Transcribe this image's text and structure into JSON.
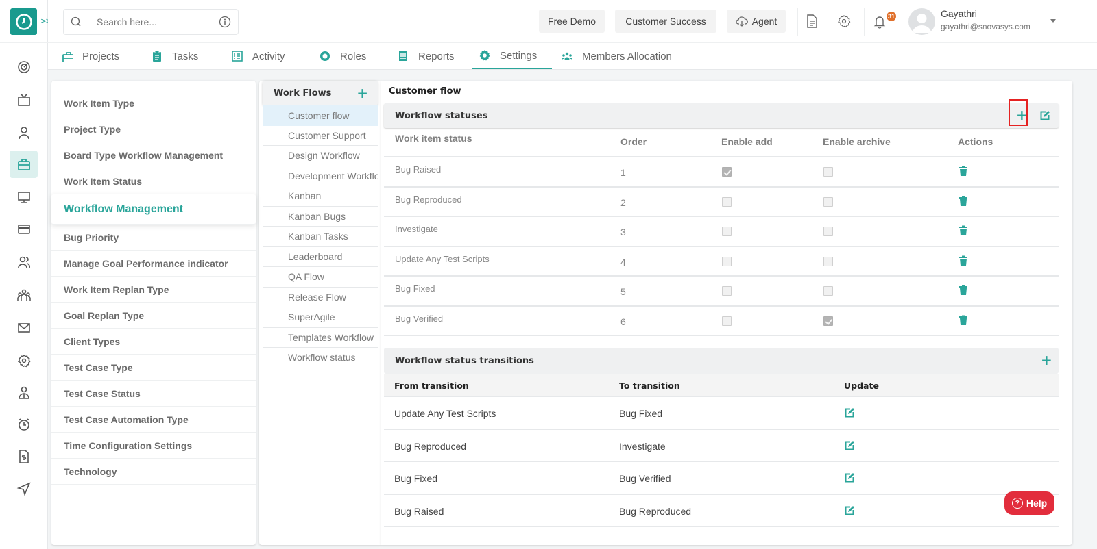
{
  "app": {
    "logo": "clock-logo",
    "expand_icon": "chevrons-right-icon"
  },
  "topbar": {
    "search_placeholder": "Search here...",
    "buttons": {
      "free_demo": "Free Demo",
      "customer_success": "Customer Success",
      "agent": "Agent"
    },
    "notification_count": "31",
    "user": {
      "name": "Gayathri",
      "email": "gayathri@snovasys.com"
    }
  },
  "rail": {
    "items": [
      "dashboard-icon",
      "tv-icon",
      "user-icon",
      "briefcase-icon",
      "monitor-icon",
      "card-icon",
      "users-icon",
      "team-icon",
      "mail-icon",
      "settings-icon",
      "person-icon",
      "alarm-icon",
      "invoice-icon",
      "send-icon"
    ],
    "active": "briefcase-icon"
  },
  "nav": {
    "tabs": [
      {
        "label": "Projects",
        "icon": "briefcase-icon"
      },
      {
        "label": "Tasks",
        "icon": "clipboard-icon"
      },
      {
        "label": "Activity",
        "icon": "list-icon"
      },
      {
        "label": "Roles",
        "icon": "gear-badge-icon"
      },
      {
        "label": "Reports",
        "icon": "report-icon"
      },
      {
        "label": "Settings",
        "icon": "gear-icon"
      },
      {
        "label": "Members Allocation",
        "icon": "members-icon"
      }
    ],
    "active": "Settings"
  },
  "settings_menu": {
    "items": [
      "Work Item Type",
      "Project Type",
      "Board Type Workflow Management",
      "Work Item Status",
      "Workflow Management",
      "Bug Priority",
      "Manage Goal Performance indicator",
      "Work Item Replan Type",
      "Goal Replan Type",
      "Client Types",
      "Test Case Type",
      "Test Case Status",
      "Test Case Automation Type",
      "Time Configuration Settings",
      "Technology"
    ],
    "active": "Workflow Management"
  },
  "workflows": {
    "title": "Work Flows",
    "items": [
      "Customer flow",
      "Customer Support",
      "Design Workflow",
      "Development Workflow",
      "Kanban",
      "Kanban Bugs",
      "Kanban Tasks",
      "Leaderboard",
      "QA Flow",
      "Release Flow",
      "SuperAgile",
      "Templates Workflow",
      "Workflow status"
    ],
    "active": "Customer flow"
  },
  "main": {
    "flow_title": "Customer flow",
    "statuses": {
      "title": "Workflow statuses",
      "columns": [
        "Work item status",
        "Order",
        "Enable add",
        "Enable archive",
        "Actions"
      ],
      "rows": [
        {
          "status": "Bug Raised",
          "order": "1",
          "enable_add": true,
          "enable_archive": false
        },
        {
          "status": "Bug Reproduced",
          "order": "2",
          "enable_add": false,
          "enable_archive": false
        },
        {
          "status": "Investigate",
          "order": "3",
          "enable_add": false,
          "enable_archive": false
        },
        {
          "status": "Update Any Test Scripts",
          "order": "4",
          "enable_add": false,
          "enable_archive": false
        },
        {
          "status": "Bug Fixed",
          "order": "5",
          "enable_add": false,
          "enable_archive": false
        },
        {
          "status": "Bug Verified",
          "order": "6",
          "enable_add": false,
          "enable_archive": true
        }
      ]
    },
    "transitions": {
      "title": "Workflow status transitions",
      "columns": [
        "From transition",
        "To transition",
        "Update"
      ],
      "rows": [
        {
          "from": "Update Any Test Scripts",
          "to": "Bug Fixed"
        },
        {
          "from": "Bug Reproduced",
          "to": "Investigate"
        },
        {
          "from": "Bug Fixed",
          "to": "Bug Verified"
        },
        {
          "from": "Bug Raised",
          "to": "Bug Reproduced"
        }
      ]
    }
  },
  "help_label": "Help",
  "colors": {
    "accent": "#2aa59a",
    "highlight": "#e52222",
    "help": "#e22d3c",
    "badge": "#e0702b"
  }
}
